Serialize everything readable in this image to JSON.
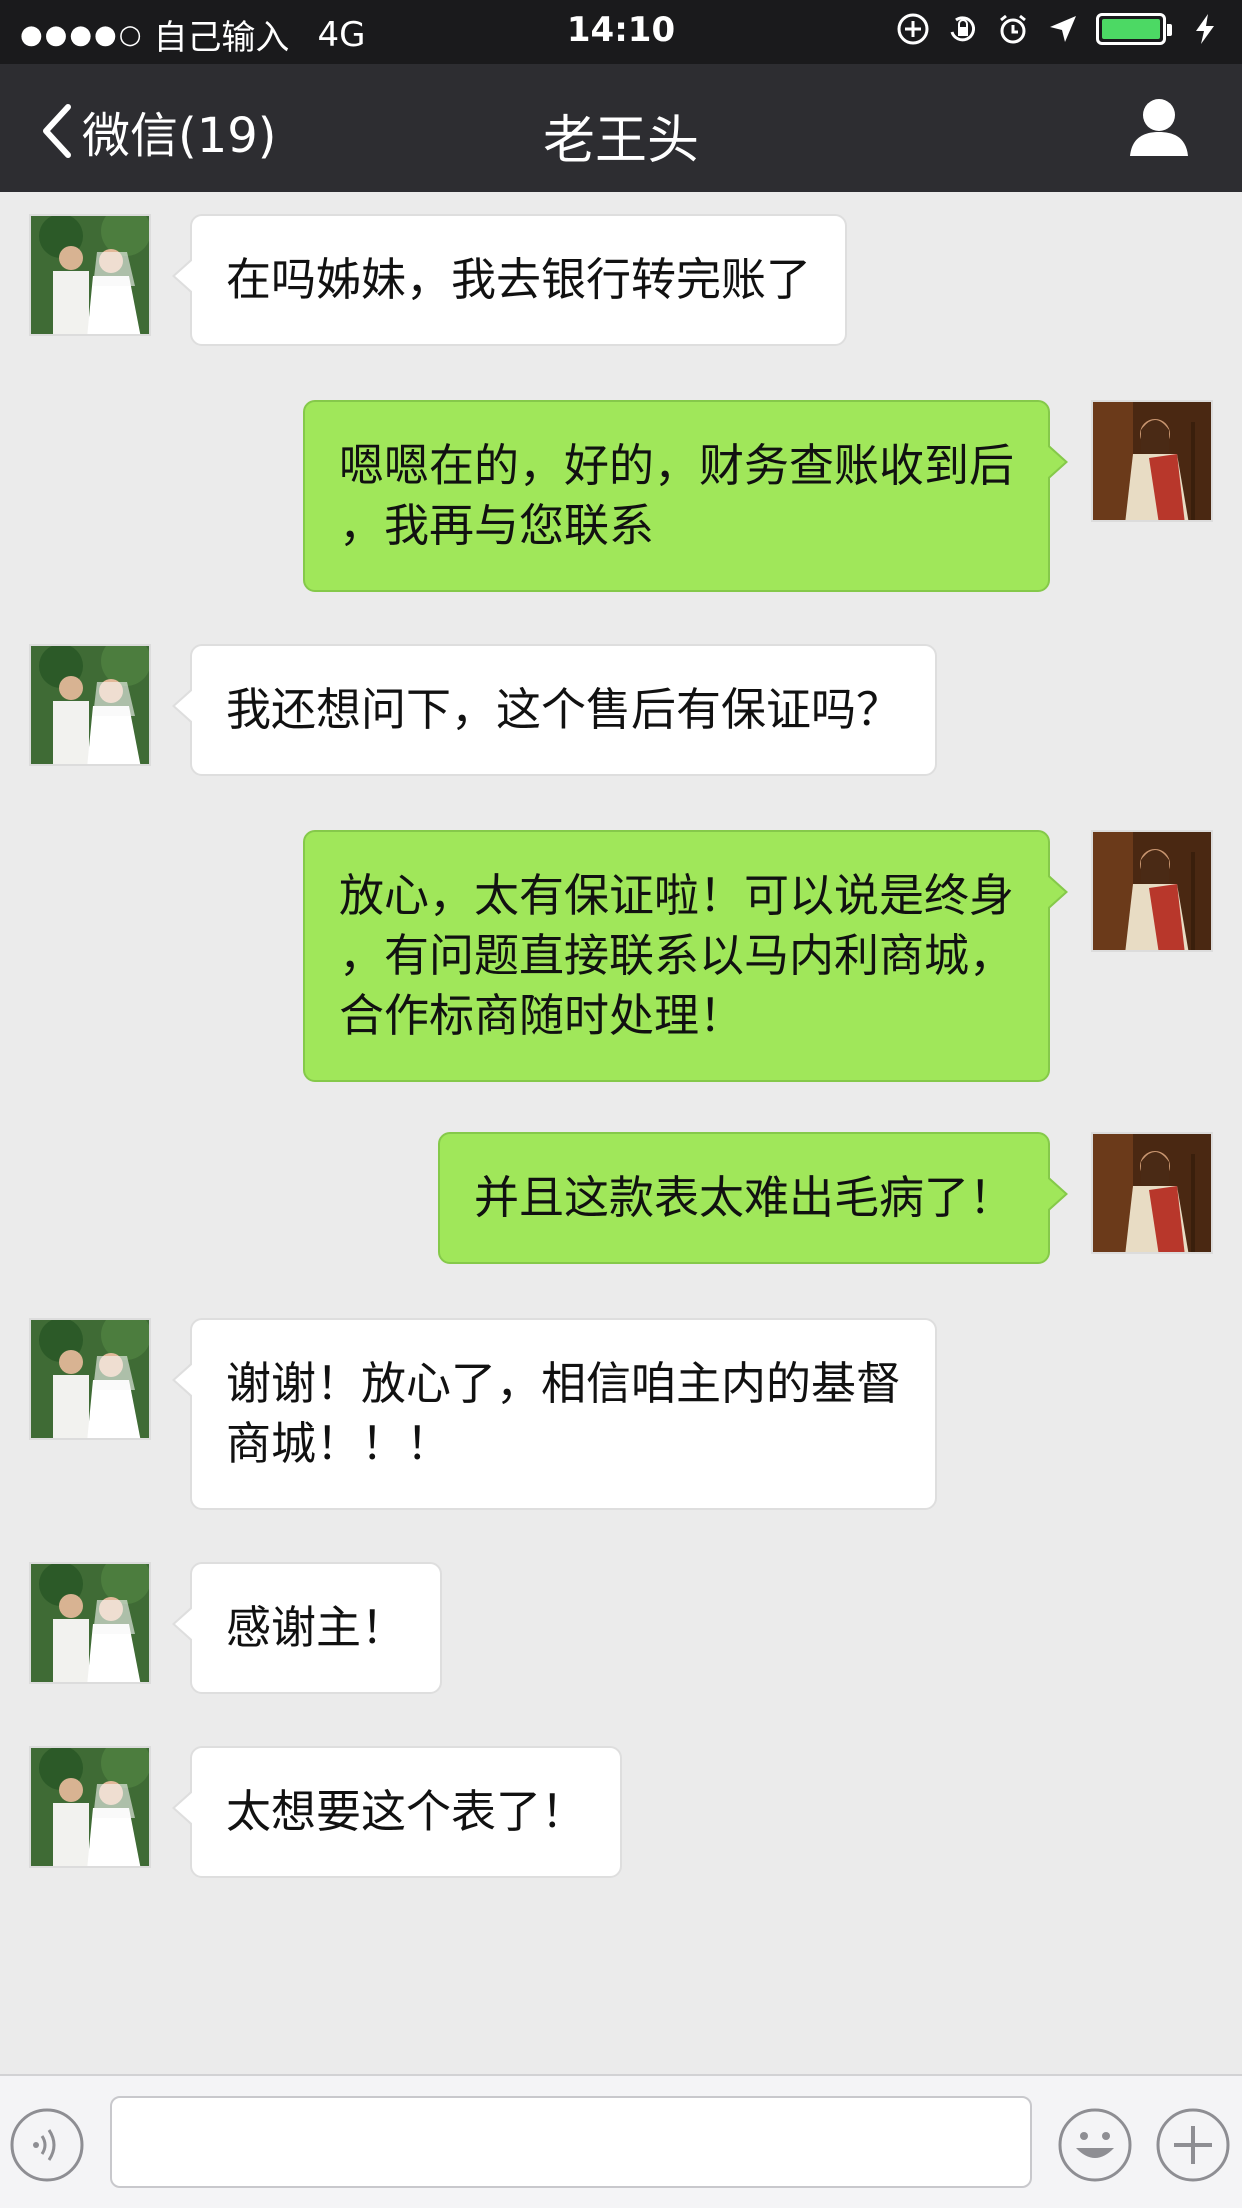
{
  "status_bar": {
    "signal": "●●●●○",
    "carrier": "自己输入",
    "network": "4G",
    "time": "14:10",
    "battery_level": 1.0
  },
  "nav": {
    "back_label": "微信(19)",
    "title": "老王头"
  },
  "messages": [
    {
      "side": "in",
      "lines": [
        "在吗姊妹，我去银行转完账了"
      ]
    },
    {
      "side": "out",
      "lines": [
        "嗯嗯在的，好的，财务查账收到后",
        "，我再与您联系"
      ]
    },
    {
      "side": "in",
      "lines": [
        "我还想问下，这个售后有保证吗？"
      ]
    },
    {
      "side": "out",
      "lines": [
        "放心，太有保证啦！可以说是终身",
        "，有问题直接联系以马内利商城，",
        "合作标商随时处理！"
      ]
    },
    {
      "side": "out",
      "lines": [
        "并且这款表太难出毛病了！"
      ]
    },
    {
      "side": "in",
      "lines": [
        "谢谢！放心了，相信咱主内的基督",
        "商城！！！"
      ]
    },
    {
      "side": "in",
      "lines": [
        "感谢主！"
      ]
    },
    {
      "side": "in",
      "lines": [
        "太想要这个表了！"
      ]
    }
  ],
  "input": {
    "text": ""
  },
  "colors": {
    "nav_bg": "#2d2d31",
    "status_bg": "#1a1a1c",
    "chat_bg": "#ebebeb",
    "out_bubble": "#a0e75a",
    "in_bubble": "#ffffff",
    "battery": "#4cd964"
  },
  "icons": [
    "back-chevron-icon",
    "profile-icon",
    "voice-icon",
    "emoji-icon",
    "plus-icon",
    "lock-rotation-icon",
    "alarm-icon",
    "location-icon",
    "charging-icon"
  ]
}
